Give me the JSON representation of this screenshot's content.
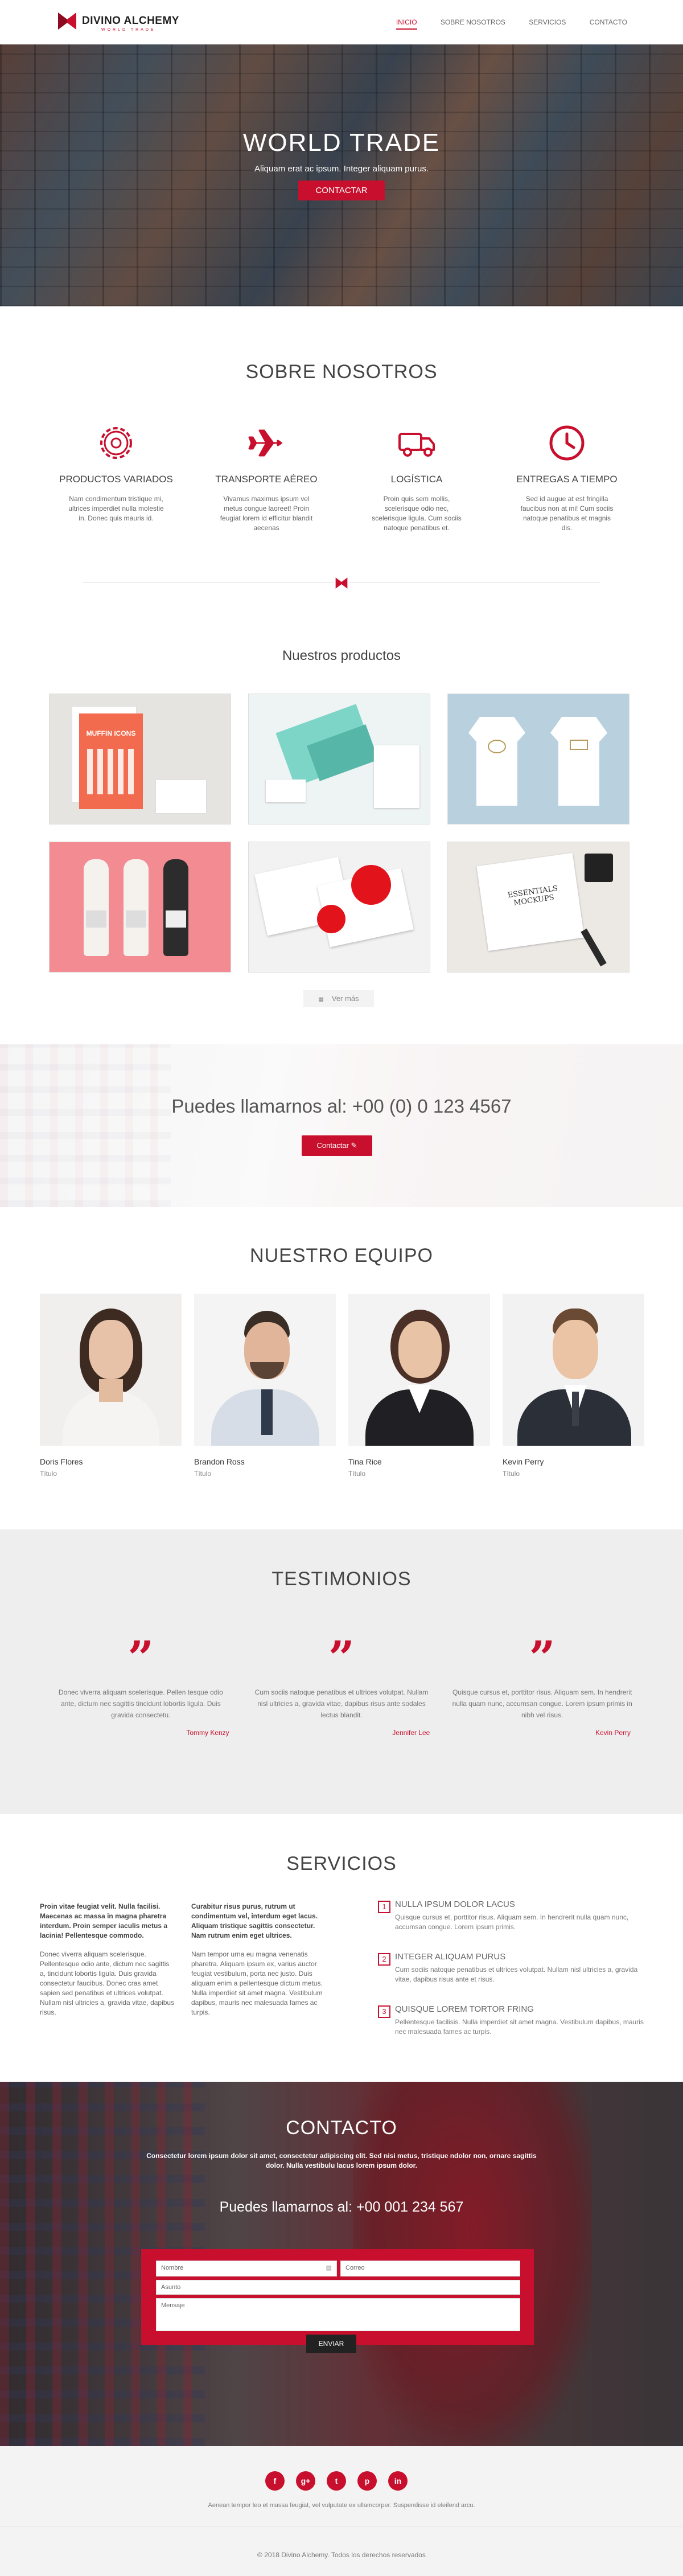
{
  "brand": {
    "name": "DIVINO ALCHEMY",
    "tagline": "WORLD TRADE",
    "accent": "#c8102e"
  },
  "nav": {
    "items": [
      {
        "label": "INICIO",
        "active": true
      },
      {
        "label": "SOBRE NOSOTROS",
        "active": false
      },
      {
        "label": "SERVICIOS",
        "active": false
      },
      {
        "label": "CONTACTO",
        "active": false
      }
    ]
  },
  "hero": {
    "title": "WORLD TRADE",
    "subtitle": "Aliquam erat ac ipsum. Integer aliquam purus.",
    "button": "CONTACTAR"
  },
  "about": {
    "title": "SOBRE NOSOTROS",
    "features": [
      {
        "icon": "gear-icon",
        "title": "PRODUCTOS VARIADOS",
        "text": "Nam condimentum tristique mi, ultrices imperdiet nulla molestie in. Donec quis mauris id."
      },
      {
        "icon": "airplane-icon",
        "title": "TRANSPORTE AÉREO",
        "text": "Vivamus maximus ipsum vel metus congue laoreet! Proin feugiat lorem id efficitur blandit aecenas"
      },
      {
        "icon": "truck-icon",
        "title": "LOGÍSTICA",
        "text": "Proin quis sem mollis, scelerisque odio nec, scelerisque ligula. Cum sociis natoque penatibus et."
      },
      {
        "icon": "clock-icon",
        "title": "ENTREGAS A TIEMPO",
        "text": "Sed id augue at est fringilla faucibus non at mi! Cum sociis natoque penatibus et magnis dis."
      }
    ]
  },
  "products": {
    "title": "Nuestros productos",
    "items": [
      {
        "name": "muffin-icons-poster",
        "text": "MUFFIN ICONS"
      },
      {
        "name": "teal-stationery",
        "text": ""
      },
      {
        "name": "tshirts",
        "text": ""
      },
      {
        "name": "bottles",
        "text": ""
      },
      {
        "name": "m-branding",
        "text": ""
      },
      {
        "name": "essentials-mockups",
        "text": "ESSENTIALS MOCKUPS"
      }
    ],
    "more_label": "Ver más"
  },
  "callus": {
    "text": "Puedes llamarnos al: +00 (0) 0 123 4567",
    "button": "Contactar"
  },
  "team": {
    "title": "NUESTRO EQUIPO",
    "members": [
      {
        "name": "Doris Flores",
        "role": "Título"
      },
      {
        "name": "Brandon Ross",
        "role": "Título"
      },
      {
        "name": "Tina Rice",
        "role": "Título"
      },
      {
        "name": "Kevin Perry",
        "role": "Título"
      }
    ]
  },
  "testimonials": {
    "title": "TESTIMONIOS",
    "items": [
      {
        "text": "Donec viverra aliquam scelerisque. Pellen tesque odio ante, dictum nec sagittis tincidunt lobortis ligula. Duis gravida consectetu.",
        "author": "Tommy Kenzy"
      },
      {
        "text": "Cum sociis natoque penatibus et ultrices volutpat. Nullam nisl ultricies a, gravida vitae, dapibus risus ante sodales lectus blandit.",
        "author": "Jennifer Lee"
      },
      {
        "text": "Quisque cursus et, porttitor risus. Aliquam sem. In hendrerit nulla quam nunc, accumsan congue. Lorem ipsum primis in nibh vel risus.",
        "author": "Kevin Perry"
      }
    ]
  },
  "services": {
    "title": "SERVICIOS",
    "col1": {
      "lead": "Proin vitae feugiat velit. Nulla facilisi. Maecenas ac massa in magna pharetra interdum. Proin semper iaculis metus a lacinia! Pellentesque commodo.",
      "body": "Donec viverra aliquam scelerisque. Pellentesque odio ante, dictum nec sagittis a, tincidunt lobortis ligula. Duis gravida consectetur faucibus. Donec cras amet sapien sed penatibus et ultrices volutpat. Nullam nisl ultricies a, gravida vitae, dapibus risus."
    },
    "col2": {
      "lead": "Curabitur risus purus, rutrum ut condimentum vel, interdum eget lacus. Aliquam tristique sagittis consectetur. Nam rutrum enim eget ultrices.",
      "body": "Nam tempor urna eu magna venenatis pharetra. Aliquam ipsum ex, varius auctor feugiat vestibulum, porta nec justo. Duis aliquam enim a pellentesque dictum metus. Nulla imperdiet sit amet magna. Vestibulum dapibus, mauris nec malesuada fames ac turpis."
    },
    "list": [
      {
        "num": "1",
        "title": "NULLA IPSUM DOLOR LACUS",
        "text": "Quisque cursus et, porttitor risus. Aliquam sem. In hendrerit nulla quam nunc, accumsan congue. Lorem ipsum primis."
      },
      {
        "num": "2",
        "title": "INTEGER ALIQUAM PURUS",
        "text": "Cum sociis natoque penatibus et ultrices volutpat. Nullam nisl ultricies a, gravida vitae, dapibus risus ante et risus."
      },
      {
        "num": "3",
        "title": "QUISQUE LOREM TORTOR FRING",
        "text": "Pellentesque facilisis. Nulla imperdiet sit amet magna. Vestibulum dapibus, mauris nec malesuada fames ac turpis."
      }
    ]
  },
  "contact": {
    "title": "CONTACTO",
    "lead": "Consectetur lorem ipsum dolor sit amet, consectetur adipiscing elit. Sed nisi metus, tristique ndolor non, ornare sagittis dolor. Nulla vestibulu lacus lorem ipsum dolor.",
    "phone": "Puedes llamarnos al: +00 001 234 567",
    "form": {
      "name_ph": "Nombre",
      "email_ph": "Correo",
      "subject_ph": "Asunto",
      "message_ph": "Mensaje",
      "send": "ENVIAR"
    }
  },
  "footer": {
    "social": [
      {
        "icon": "facebook-icon",
        "glyph": "f"
      },
      {
        "icon": "google-plus-icon",
        "glyph": "g+"
      },
      {
        "icon": "twitter-icon",
        "glyph": "t"
      },
      {
        "icon": "pinterest-icon",
        "glyph": "p"
      },
      {
        "icon": "linkedin-icon",
        "glyph": "in"
      }
    ],
    "text": "Aenean tempor leo et massa feugiat, vel vulputate ex ullamcorper. Suspendisse id eleifend arcu.",
    "copyright": "© 2018 Divino Alchemy. Todos los derechos reservados"
  }
}
